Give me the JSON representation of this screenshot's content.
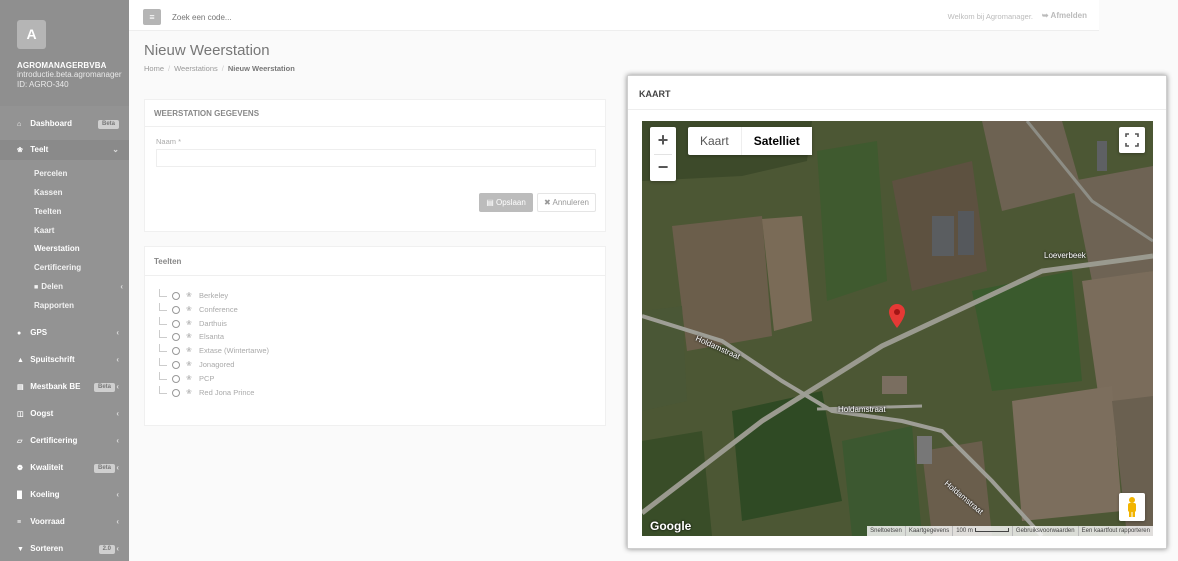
{
  "sidebar": {
    "avatar": "A",
    "company": "AGROMANAGERBVBA",
    "company_sub1": "introductie.beta.agromanager",
    "company_sub2": "ID: AGRO-340",
    "items": [
      {
        "label": "Dashboard",
        "badge": "Beta",
        "icon": "home-icon"
      },
      {
        "label": "Teelt",
        "icon": "leaf-icon"
      },
      {
        "label": "GPS",
        "icon": "map-marker-icon"
      },
      {
        "label": "Spuitschrift",
        "icon": "drop-icon"
      },
      {
        "label": "Mestbank BE",
        "badge": "Beta",
        "icon": "bank-icon"
      },
      {
        "label": "Oogst",
        "icon": "basket-icon"
      },
      {
        "label": "Certificering",
        "icon": "certificate-icon"
      },
      {
        "label": "Kwaliteit",
        "badge": "Beta",
        "icon": "quality-icon"
      },
      {
        "label": "Koeling",
        "icon": "thermometer-icon"
      },
      {
        "label": "Voorraad",
        "icon": "list-icon"
      },
      {
        "label": "Sorteren",
        "badge": "2.0",
        "icon": "filter-icon"
      }
    ],
    "teelt_sub": [
      "Percelen",
      "Kassen",
      "Teelten",
      "Kaart",
      "Weerstation",
      "Certificering",
      "Delen",
      "Rapporten"
    ]
  },
  "topbar": {
    "search_placeholder": "Zoek een code...",
    "welcome": "Welkom bij Agromanager.",
    "logout": "Afmelden"
  },
  "page": {
    "title": "Nieuw Weerstation",
    "breadcrumb": [
      "Home",
      "Weerstations",
      "Nieuw Weerstation"
    ]
  },
  "form": {
    "title": "WEERSTATION GEGEVENS",
    "name_label": "Naam *",
    "name_value": "",
    "save": "Opslaan",
    "cancel": "Annuleren"
  },
  "teelten": {
    "title": "Teelten",
    "items": [
      "Berkeley",
      "Conference",
      "Darthuis",
      "Elsanta",
      "Extase (Wintertarwe)",
      "Jonagored",
      "PCP",
      "Red Jona Prince"
    ]
  },
  "map": {
    "title": "KAART",
    "type_map": "Kaart",
    "type_satellite": "Satelliet",
    "selected_type": "Satelliet",
    "roads": [
      "Holdamstraat",
      "Holdamstraat",
      "Holdamstraat",
      "Loeverbeek"
    ],
    "google": "Google",
    "attribution": [
      "Sneltoetsen",
      "Kaartgegevens",
      "100 m",
      "Gebruiksvoorwaarden",
      "Een kaartfout rapporteren"
    ]
  }
}
